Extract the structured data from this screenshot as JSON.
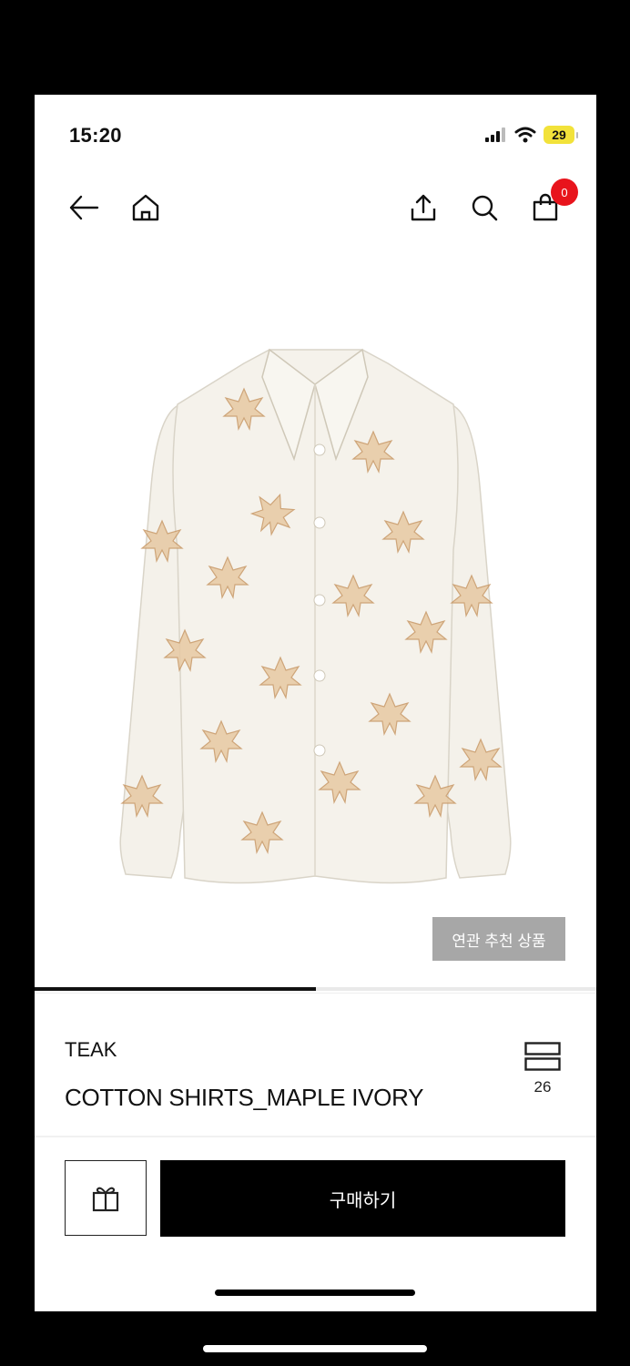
{
  "status_bar": {
    "time": "15:20",
    "battery": "29"
  },
  "nav": {
    "cart_count": "0"
  },
  "gallery": {
    "related_label": "연관 추천 상품",
    "progress": 0.5
  },
  "product": {
    "brand": "TEAK",
    "name": "COTTON SHIRTS_MAPLE IVORY",
    "wish_count": "26"
  },
  "actions": {
    "buy_label": "구매하기"
  },
  "colors": {
    "badge": "#e8141c",
    "battery": "#f2e23a",
    "buy_button": "#000000",
    "related_button": "#a7a7a7"
  }
}
